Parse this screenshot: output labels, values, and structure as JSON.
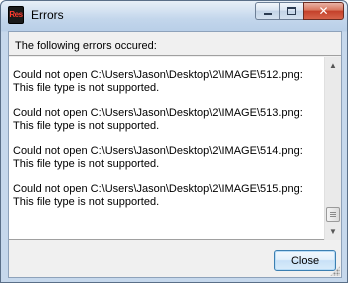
{
  "window": {
    "title": "Errors",
    "app_icon_text": "Res",
    "controls": {
      "minimize_icon": "minimize-icon",
      "maximize_icon": "maximize-icon",
      "close_glyph": "✕"
    }
  },
  "dialog": {
    "header": "The following errors occured:",
    "errors": [
      {
        "line1": "Could not open C:\\Users\\Jason\\Desktop\\2\\IMAGE\\512.png:",
        "line2": "This file type is not supported."
      },
      {
        "line1": "Could not open C:\\Users\\Jason\\Desktop\\2\\IMAGE\\513.png:",
        "line2": "This file type is not supported."
      },
      {
        "line1": "Could not open C:\\Users\\Jason\\Desktop\\2\\IMAGE\\514.png:",
        "line2": "This file type is not supported."
      },
      {
        "line1": "Could not open C:\\Users\\Jason\\Desktop\\2\\IMAGE\\515.png:",
        "line2": "This file type is not supported."
      }
    ],
    "close_label": "Close"
  },
  "colors": {
    "title_bar": "#b9cfe8",
    "close_button_accent": "#c4402a",
    "focus_border": "#3c7fb1"
  }
}
